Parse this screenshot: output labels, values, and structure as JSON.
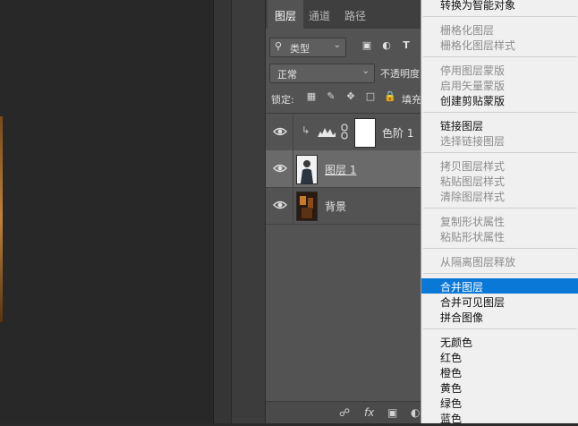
{
  "layers_panel": {
    "tabs": [
      "图层",
      "通道",
      "路径"
    ],
    "filter": {
      "label": "类型"
    },
    "blend_mode": {
      "value": "正常"
    },
    "opacity_label": "不透明度",
    "lock_label": "锁定:",
    "fill_label": "填充",
    "layers": [
      {
        "name": "色阶 1",
        "type": "adjustment"
      },
      {
        "name": "图层 1",
        "type": "photo",
        "selected": true
      },
      {
        "name": "背景",
        "type": "background"
      }
    ]
  },
  "context_menu": {
    "top_item": "转换为智能对象",
    "groups": [
      [
        {
          "label": "栅格化图层",
          "disabled": true
        },
        {
          "label": "栅格化图层样式",
          "disabled": true
        }
      ],
      [
        {
          "label": "停用图层蒙版",
          "disabled": true
        },
        {
          "label": "启用矢量蒙版",
          "disabled": true
        },
        {
          "label": "创建剪贴蒙版",
          "disabled": false
        }
      ],
      [
        {
          "label": "链接图层",
          "disabled": false
        },
        {
          "label": "选择链接图层",
          "disabled": true
        }
      ],
      [
        {
          "label": "拷贝图层样式",
          "disabled": true
        },
        {
          "label": "粘贴图层样式",
          "disabled": true
        },
        {
          "label": "清除图层样式",
          "disabled": true
        }
      ],
      [
        {
          "label": "复制形状属性",
          "disabled": true
        },
        {
          "label": "粘贴形状属性",
          "disabled": true
        }
      ],
      [
        {
          "label": "从隔离图层释放",
          "disabled": true
        }
      ],
      [
        {
          "label": "合并图层",
          "disabled": false,
          "highlighted": true
        },
        {
          "label": "合并可见图层",
          "disabled": false
        },
        {
          "label": "拼合图像",
          "disabled": false
        }
      ],
      [
        {
          "label": "无颜色",
          "disabled": false
        },
        {
          "label": "红色",
          "disabled": false
        },
        {
          "label": "橙色",
          "disabled": false
        },
        {
          "label": "黄色",
          "disabled": false
        },
        {
          "label": "绿色",
          "disabled": false
        },
        {
          "label": "蓝色",
          "disabled": false
        }
      ]
    ]
  },
  "colors": {
    "accent": "#0a78d7"
  }
}
